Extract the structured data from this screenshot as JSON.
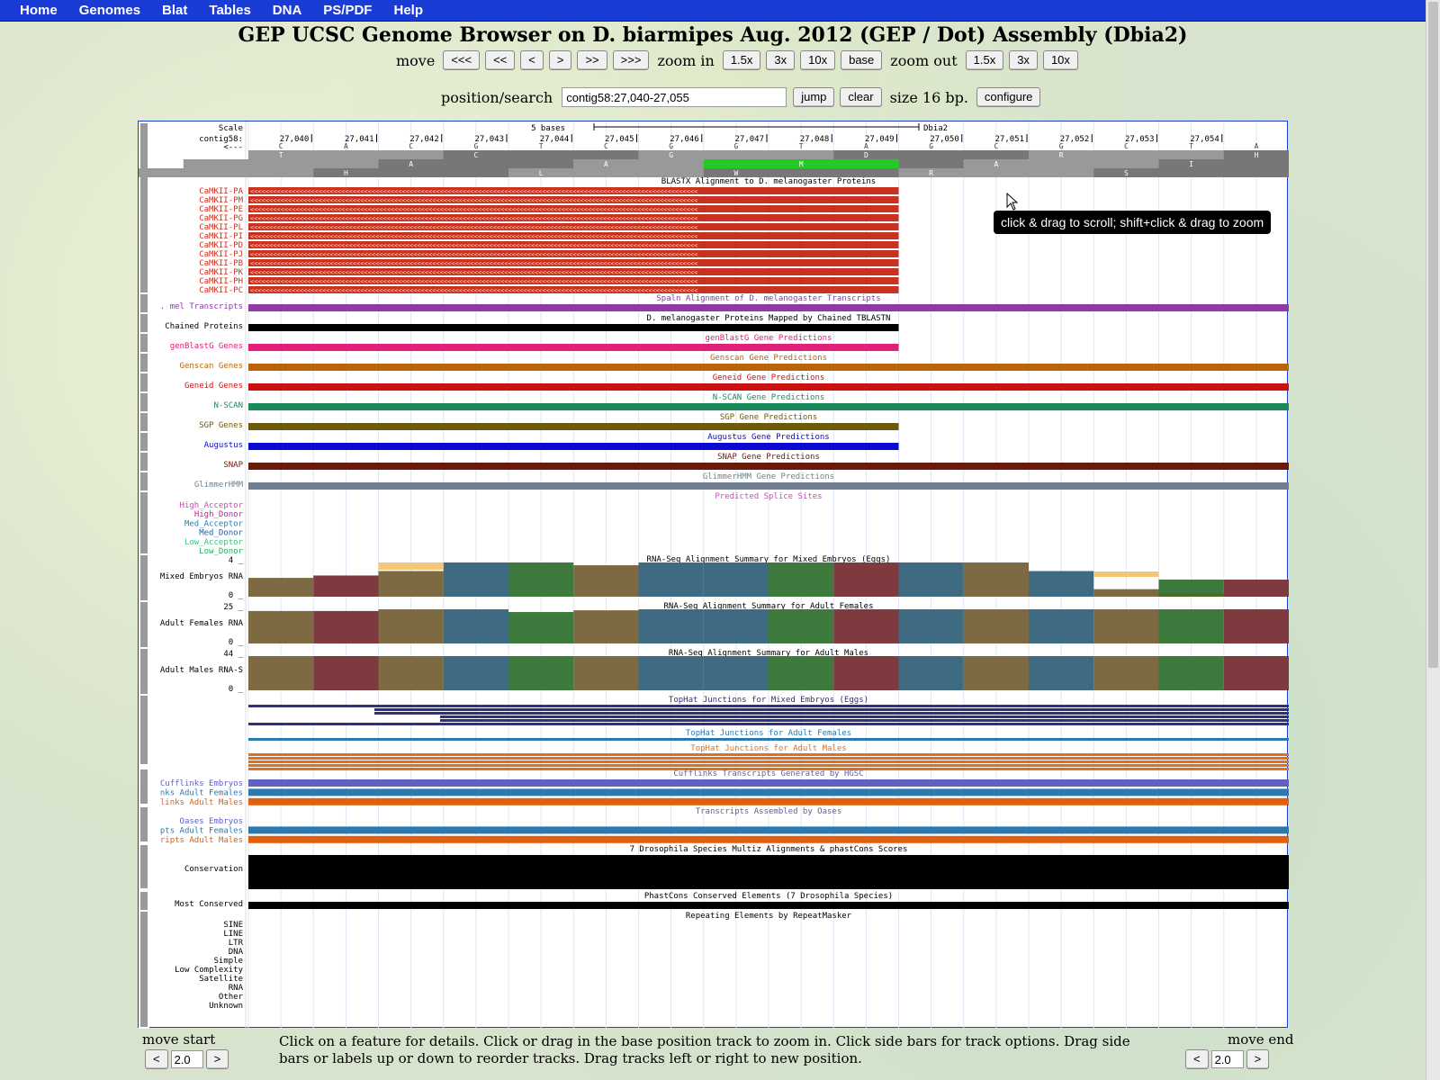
{
  "nav": {
    "items": [
      "Home",
      "Genomes",
      "Blat",
      "Tables",
      "DNA",
      "PS/PDF",
      "Help"
    ]
  },
  "title": "GEP UCSC Genome Browser on D. biarmipes Aug. 2012 (GEP / Dot) Assembly (Dbia2)",
  "controls": {
    "move_label": "move",
    "move_buttons": [
      "<<<",
      "<<",
      "<",
      ">",
      ">>",
      ">>>"
    ],
    "zoom_in_label": "zoom in",
    "zoom_in_buttons": [
      "1.5x",
      "3x",
      "10x",
      "base"
    ],
    "zoom_out_label": "zoom out",
    "zoom_out_buttons": [
      "1.5x",
      "3x",
      "10x"
    ],
    "position_label": "position/search",
    "position_value": "contig58:27,040-27,055",
    "jump": "jump",
    "clear": "clear",
    "size_text": "size 16 bp.",
    "configure": "configure"
  },
  "tooltip": "click & drag to scroll; shift+click & drag to zoom",
  "ruler": {
    "scale_label": "Scale",
    "chrom_label": "contig58:",
    "strand_label": "<---",
    "scale_text": "5 bases",
    "assembly": "Dbia2",
    "positions": [
      "27,040",
      "27,041",
      "27,042",
      "27,043",
      "27,044",
      "27,045",
      "27,046",
      "27,047",
      "27,048",
      "27,049",
      "27,050",
      "27,051",
      "27,052",
      "27,053",
      "27,054"
    ],
    "bases": [
      "C",
      "A",
      "C",
      "G",
      "T",
      "C",
      "G",
      "G",
      "T",
      "A",
      "G",
      "C",
      "G",
      "C",
      "T",
      "A"
    ],
    "frame1": [
      "T",
      "",
      "",
      "C",
      "",
      "",
      "G",
      "",
      "",
      "D",
      "",
      "",
      "R",
      "",
      "",
      "H"
    ],
    "frame2": [
      "",
      "",
      "A",
      "",
      "",
      "A",
      "",
      "",
      "M",
      "",
      "",
      "A",
      "",
      "",
      "I",
      ""
    ],
    "frame3": [
      "",
      "H",
      "",
      "",
      "L",
      "",
      "",
      "W",
      "",
      "",
      "R",
      "",
      "",
      "S",
      "",
      ""
    ]
  },
  "tracks": {
    "blastx": {
      "title": "BLASTX Alignment to D. melanogaster Proteins",
      "color": "#c8321e",
      "labels": [
        "CaMKII-PA",
        "CaMKII-PM",
        "CaMKII-PE",
        "CaMKII-PG",
        "CaMKII-PL",
        "CaMKII-PI",
        "CaMKII-PD",
        "CaMKII-PJ",
        "CaMKII-PB",
        "CaMKII-PK",
        "CaMKII-PH",
        "CaMKII-PC"
      ]
    },
    "spaln": {
      "title": "Spaln Alignment of D. melanogaster Transcripts",
      "label": ". mel Transcripts",
      "color": "#8e3aa8"
    },
    "chained": {
      "title": "D. melanogaster Proteins Mapped by Chained TBLASTN",
      "label": "Chained Proteins",
      "color": "#000000"
    },
    "genblast": {
      "title": "genBlastG Gene Predictions",
      "label": "genBlastG Genes",
      "color": "#e0207a"
    },
    "genscan": {
      "title": "Genscan Gene Predictions",
      "label": "Genscan Genes",
      "color": "#b8650a"
    },
    "geneid": {
      "title": "Geneid Gene Predictions",
      "label": "Geneid Genes",
      "color": "#cc1111"
    },
    "nscan": {
      "title": "N-SCAN Gene Predictions",
      "label": "N-SCAN",
      "color": "#1a8a5a"
    },
    "sgp": {
      "title": "SGP Gene Predictions",
      "label": "SGP Genes",
      "color": "#6b5a0a"
    },
    "augustus": {
      "title": "Augustus Gene Predictions",
      "label": "Augustus",
      "color": "#0a0ad0"
    },
    "snap": {
      "title": "SNAP Gene Predictions",
      "label": "SNAP",
      "color": "#6a1a0a"
    },
    "glimmer": {
      "title": "GlimmerHMM Gene Predictions",
      "label": "GlimmerHMM",
      "color": "#708090"
    },
    "splice": {
      "title": "Predicted Splice Sites",
      "labels": [
        "High_Acceptor",
        "High_Donor",
        "Med_Acceptor",
        "Med_Donor",
        "Low_Acceptor",
        "Low_Donor"
      ],
      "colors": [
        "#e040c0",
        "#c020a0",
        "#2080c0",
        "#1a60b0",
        "#40c080",
        "#20b060"
      ]
    },
    "rna_embryo": {
      "title": "RNA-Seq Alignment Summary for Mixed Embryos (Eggs)",
      "label": "Mixed Embryos RNA",
      "max": "4",
      "min": "0"
    },
    "rna_female": {
      "title": "RNA-Seq Alignment Summary for Adult Females",
      "label": "Adult Females RNA",
      "max": "25",
      "min": "0"
    },
    "rna_male": {
      "title": "RNA-Seq Alignment Summary for Adult Males",
      "label": "Adult Males RNA-S",
      "max": "44",
      "min": "0"
    },
    "tophat_embryo": {
      "title": "TopHat Junctions for Mixed Embryos (Eggs)",
      "color": "#303080"
    },
    "tophat_female": {
      "title": "TopHat Junctions for Adult Females",
      "color": "#2a7ab0"
    },
    "tophat_male": {
      "title": "TopHat Junctions for Adult Males",
      "color": "#e07020"
    },
    "cufflinks": {
      "title": "Cufflinks Transcripts Generated by HGSC",
      "labels": [
        "Cufflinks Embryos",
        "nks Adult Females",
        "links Adult Males"
      ],
      "colors": [
        "#6060c0",
        "#2a7ab0",
        "#e06010"
      ]
    },
    "oases": {
      "title": "Transcripts Assembled by Oases",
      "labels": [
        "Oases Embryos",
        "pts Adult Females",
        "ripts Adult Males"
      ],
      "colors": [
        "#6060c0",
        "#2a7ab0",
        "#e06010"
      ]
    },
    "multiz": {
      "title": "7 Drosophila Species Multiz Alignments & phastCons Scores",
      "label": "Conservation"
    },
    "phastcons": {
      "title": "PhastCons Conserved Elements (7 Drosophila Species)",
      "label": "Most Conserved"
    },
    "repeatmasker": {
      "title": "Repeating Elements by RepeatMasker",
      "labels": [
        "SINE",
        "LINE",
        "LTR",
        "DNA",
        "Simple",
        "Low Complexity",
        "Satellite",
        "RNA",
        "Other",
        "Unknown"
      ]
    }
  },
  "rna_bars": {
    "embryo": [
      0.55,
      0.62,
      0.75,
      1.0,
      1.0,
      0.92,
      1.0,
      1.0,
      1.0,
      1.0,
      1.0,
      1.0,
      0.75,
      0.22,
      0.5,
      0.5
    ],
    "female": [
      0.95,
      0.95,
      1.0,
      1.0,
      0.92,
      0.97,
      1.0,
      1.0,
      1.0,
      1.0,
      1.0,
      1.0,
      1.0,
      1.0,
      1.0,
      1.0
    ],
    "male": [
      1.0,
      1.0,
      1.0,
      1.0,
      1.0,
      1.0,
      1.0,
      1.0,
      1.0,
      1.0,
      1.0,
      1.0,
      1.0,
      1.0,
      1.0,
      1.0
    ]
  },
  "bar_colors": [
    "#7d6a42",
    "#7e3a3e",
    "#7d6a42",
    "#3e6a82",
    "#3e7a3e",
    "#7d6a42",
    "#3e6a82",
    "#3e6a82",
    "#3e7a3e",
    "#7e3a3e",
    "#3e6a82",
    "#7d6a42",
    "#3e6a82",
    "#7d6a42",
    "#3e7a3e",
    "#7e3a3e"
  ],
  "footer": {
    "move_start": "move start",
    "move_end": "move end",
    "left_btn": "<",
    "right_btn": ">",
    "step_value": "2.0",
    "help": "Click on a feature for details. Click or drag in the base position track to zoom in. Click side bars for track options. Drag side bars or labels up or down to reorder tracks. Drag tracks left or right to new position."
  }
}
